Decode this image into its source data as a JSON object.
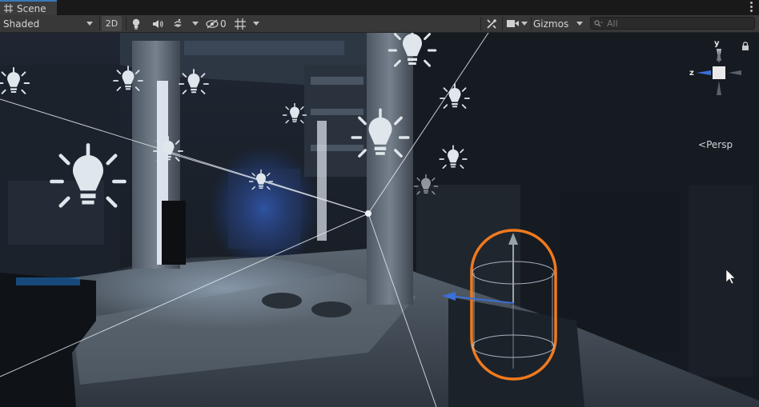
{
  "window": {
    "tab_label": "Scene",
    "tab_icon": "grid-icon"
  },
  "toolbar": {
    "shading_mode": "Shaded",
    "toggle_2d": "2D",
    "hidden_count": "0",
    "gizmos_label": "Gizmos",
    "search_placeholder": "All",
    "icons": [
      "light-icon",
      "audio-icon",
      "effects-icon",
      "visibility-icon",
      "grid-snap-icon",
      "tools-icon",
      "camera-icon",
      "search-icon"
    ]
  },
  "orientation_gizmo": {
    "axis_y": "y",
    "axis_z": "z",
    "projection": "Persp"
  },
  "colors": {
    "tab_accent": "#3a79bb",
    "selection_outline": "#f07a1e",
    "axis_y": "#9aa4a8",
    "axis_z": "#3c6fd6",
    "axis_x": "#c45050"
  }
}
